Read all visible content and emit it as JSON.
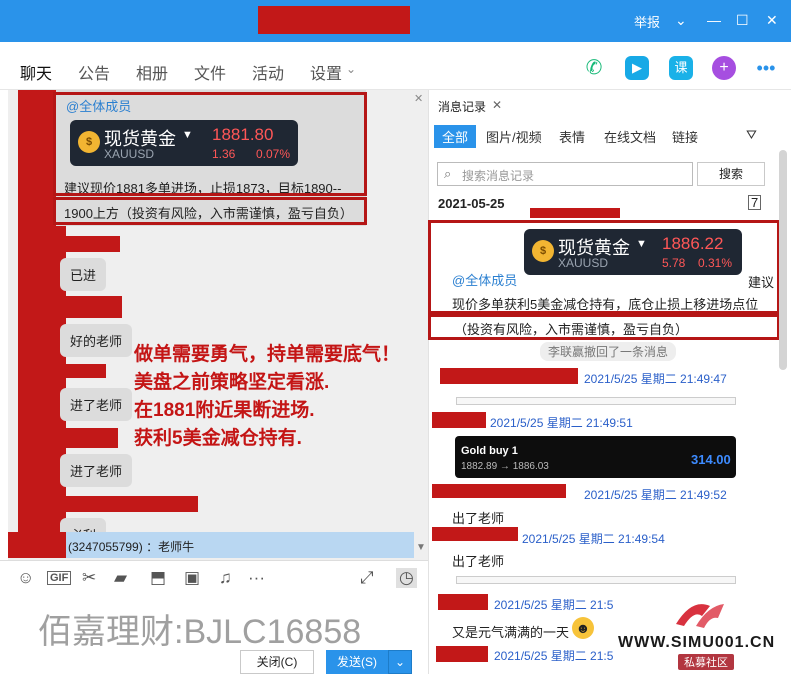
{
  "window": {
    "report_label": "举报"
  },
  "tabs": [
    "聊天",
    "公告",
    "相册",
    "文件",
    "活动",
    "设置"
  ],
  "chat": {
    "mention": "@全体成员",
    "quote1": {
      "name": "现货黄金",
      "code": "XAUUSD",
      "price": "1881.80",
      "change": "1.36",
      "pct": "0.07%"
    },
    "advice_line1": "建议现价1881多单进场，止损1873，目标1890--",
    "advice_line2": "1900上方（投资有风险，入市需谨慎，盈亏自负）",
    "messages": [
      "已进",
      "好的老师",
      "进了老师",
      "进了老师",
      "必利"
    ],
    "reply_preview": "(3247055799) ：老师牛",
    "overlay": [
      "做单需要勇气，持单需要底气！",
      "美盘之前策略坚定看涨.",
      "在1881附近果断进场.",
      "获利5美金减仓持有."
    ]
  },
  "composer": {
    "watermark": "佰嘉理财:BJLC16858",
    "close_label": "关闭(C)",
    "send_label": "发送(S)"
  },
  "history": {
    "tab_label": "消息记录",
    "filters": [
      "全部",
      "图片/视频",
      "表情",
      "在线文档",
      "链接"
    ],
    "search_placeholder": "搜索消息记录",
    "search_button": "搜索",
    "date": "2021-05-25",
    "quote2": {
      "name": "现货黄金",
      "code": "XAUUSD",
      "price": "1886.22",
      "change": "5.78",
      "pct": "0.31%"
    },
    "mention": "@全体成员",
    "advice_tail": "建议",
    "hold_line": "现价多单获利5美金减仓持有，底仓止损上移进场点位",
    "risk_line": "（投资有风险，入市需谨慎，盈亏自负）",
    "recall_notice": "李联赢撤回了一条消息",
    "timestamps": [
      "2021/5/25 星期二 21:49:47",
      "2021/5/25 星期二 21:49:51",
      "2021/5/25 星期二 21:49:52",
      "2021/5/25 星期二 21:49:54",
      "2021/5/25 星期二 21:5",
      "2021/5/25 星期二 21:5"
    ],
    "trade": {
      "title": "Gold buy 1",
      "prices": "1882.89 → 1886.03",
      "profit": "314.00"
    },
    "messages": [
      "出了老师",
      "出了老师",
      "又是元气满满的一天"
    ]
  },
  "watermark_site": {
    "url": "WWW.SIMU001.CN",
    "tag": "私募社区"
  },
  "colors": {
    "titlebar": "#2a93ea",
    "highlight": "#b51616",
    "accent_red": "#c41515"
  }
}
